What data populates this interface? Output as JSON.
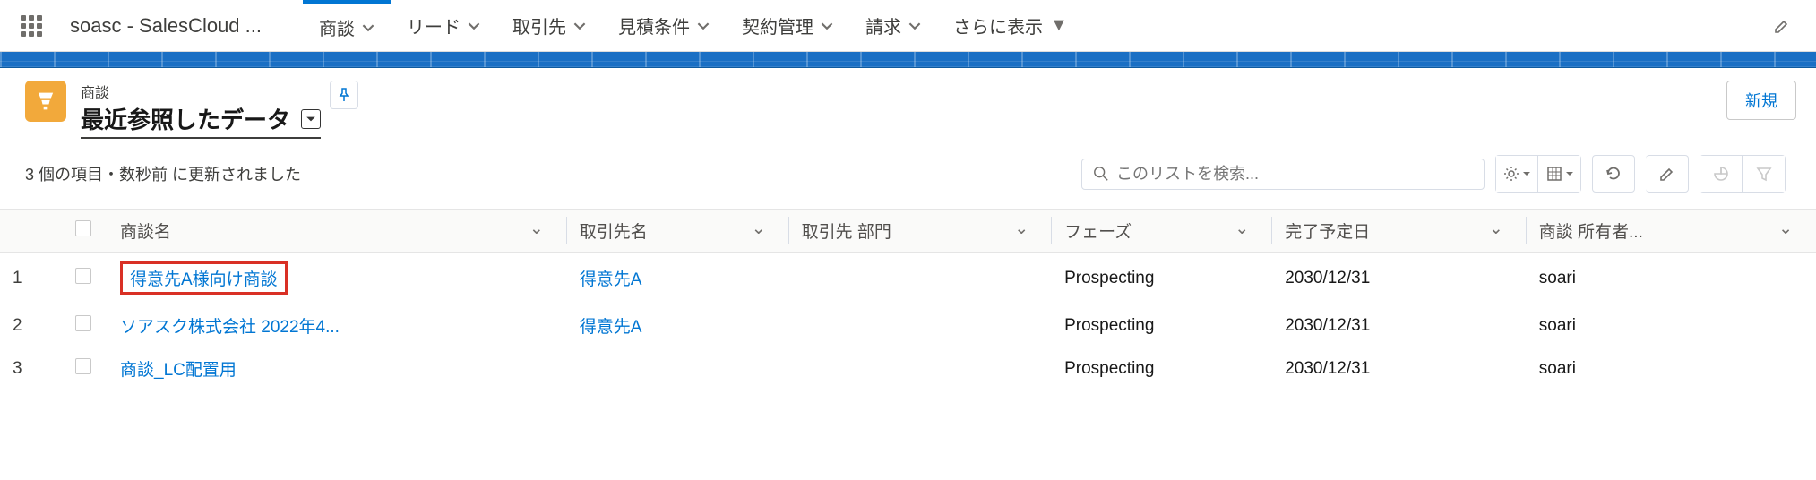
{
  "app": {
    "name": "soasc - SalesCloud ..."
  },
  "nav": {
    "tabs": [
      {
        "label": "商談",
        "active": true
      },
      {
        "label": "リード"
      },
      {
        "label": "取引先"
      },
      {
        "label": "見積条件"
      },
      {
        "label": "契約管理"
      },
      {
        "label": "請求"
      },
      {
        "label": "さらに表示"
      }
    ]
  },
  "object": {
    "label": "商談"
  },
  "listview": {
    "title": "最近参照したデータ",
    "meta": "3 個の項目・数秒前 に更新されました",
    "new_button": "新規",
    "search_placeholder": "このリストを検索..."
  },
  "columns": {
    "name": "商談名",
    "account": "取引先名",
    "dept": "取引先 部門",
    "phase": "フェーズ",
    "close": "完了予定日",
    "owner": "商談 所有者..."
  },
  "rows": [
    {
      "num": "1",
      "name": "得意先A様向け商談",
      "account": "得意先A",
      "dept": "",
      "phase": "Prospecting",
      "close": "2030/12/31",
      "owner": "soari",
      "highlight": true
    },
    {
      "num": "2",
      "name": "ソアスク株式会社 2022年4...",
      "account": "得意先A",
      "dept": "",
      "phase": "Prospecting",
      "close": "2030/12/31",
      "owner": "soari"
    },
    {
      "num": "3",
      "name": "商談_LC配置用",
      "account": "",
      "dept": "",
      "phase": "Prospecting",
      "close": "2030/12/31",
      "owner": "soari"
    }
  ]
}
